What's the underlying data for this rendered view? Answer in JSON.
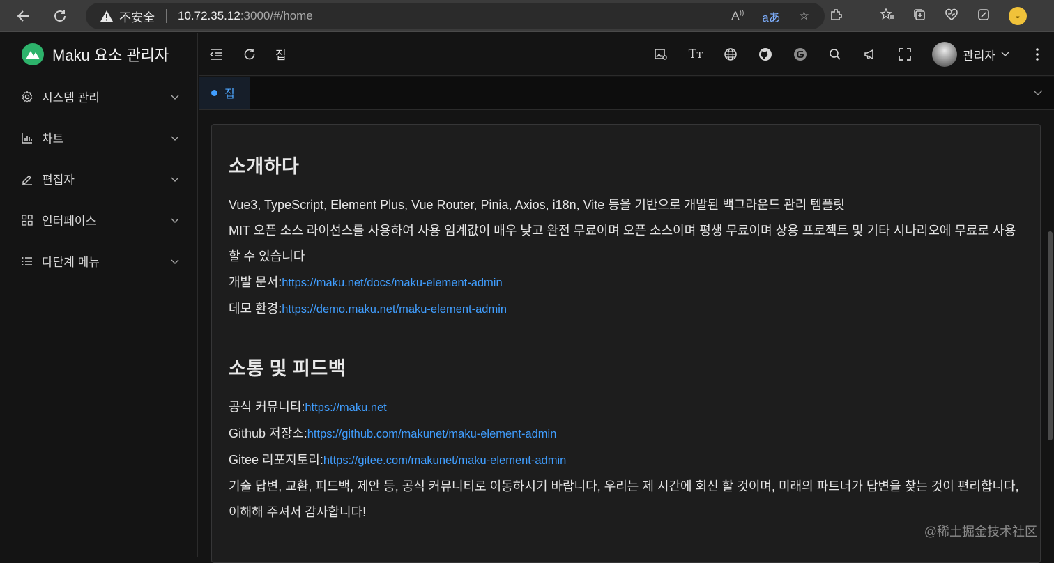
{
  "browser": {
    "security_label": "不安全",
    "url_host": "10.72.35.12",
    "url_rest": ":3000/#/home"
  },
  "sidebar": {
    "app_title": "Maku 요소 관리자",
    "items": [
      {
        "label": "시스템 관리",
        "icon": "gear-icon"
      },
      {
        "label": "차트",
        "icon": "bar-chart-icon"
      },
      {
        "label": "편집자",
        "icon": "edit-icon"
      },
      {
        "label": "인터페이스",
        "icon": "grid-icon"
      },
      {
        "label": "다단계 메뉴",
        "icon": "list-icon"
      }
    ]
  },
  "header": {
    "breadcrumb": "집",
    "user_name": "관리자"
  },
  "tabs": [
    {
      "label": "집",
      "active": true
    }
  ],
  "content": {
    "intro": {
      "title": "소개하다",
      "line1": "Vue3, TypeScript, Element Plus, Vue Router, Pinia, Axios, i18n, Vite 등을 기반으로 개발된 백그라운드 관리 템플릿",
      "line2": "MIT 오픈 소스 라이선스를 사용하여 사용 임계값이 매우 낮고 완전 무료이며 오픈 소스이며 평생 무료이며 상용 프로젝트 및 기타 시나리오에 무료로 사용할 수 있습니다",
      "docs_label": "개발 문서:",
      "docs_url": "https://maku.net/docs/maku-element-admin",
      "demo_label": "데모 환경:",
      "demo_url": "https://demo.maku.net/maku-element-admin"
    },
    "feedback": {
      "title": "소통 및 피드백",
      "community_label": "공식 커뮤니티:",
      "community_url": "https://maku.net",
      "github_label": "Github 저장소:",
      "github_url": "https://github.com/makunet/maku-element-admin",
      "gitee_label": "Gitee 리포지토리:",
      "gitee_url": "https://gitee.com/makunet/maku-element-admin",
      "closing": "기술 답변, 교환, 피드백, 제안 등, 공식 커뮤니티로 이동하시기 바랍니다, 우리는 제 시간에 회신 할 것이며, 미래의 파트너가 답변을 찾는 것이 편리합니다, 이해해 주셔서 감사합니다!"
    }
  },
  "watermark": "@稀土掘金技术社区",
  "colors": {
    "accent": "#409eff",
    "logo": "#2db36b",
    "background": "#141414",
    "card": "#1d1d1d"
  }
}
